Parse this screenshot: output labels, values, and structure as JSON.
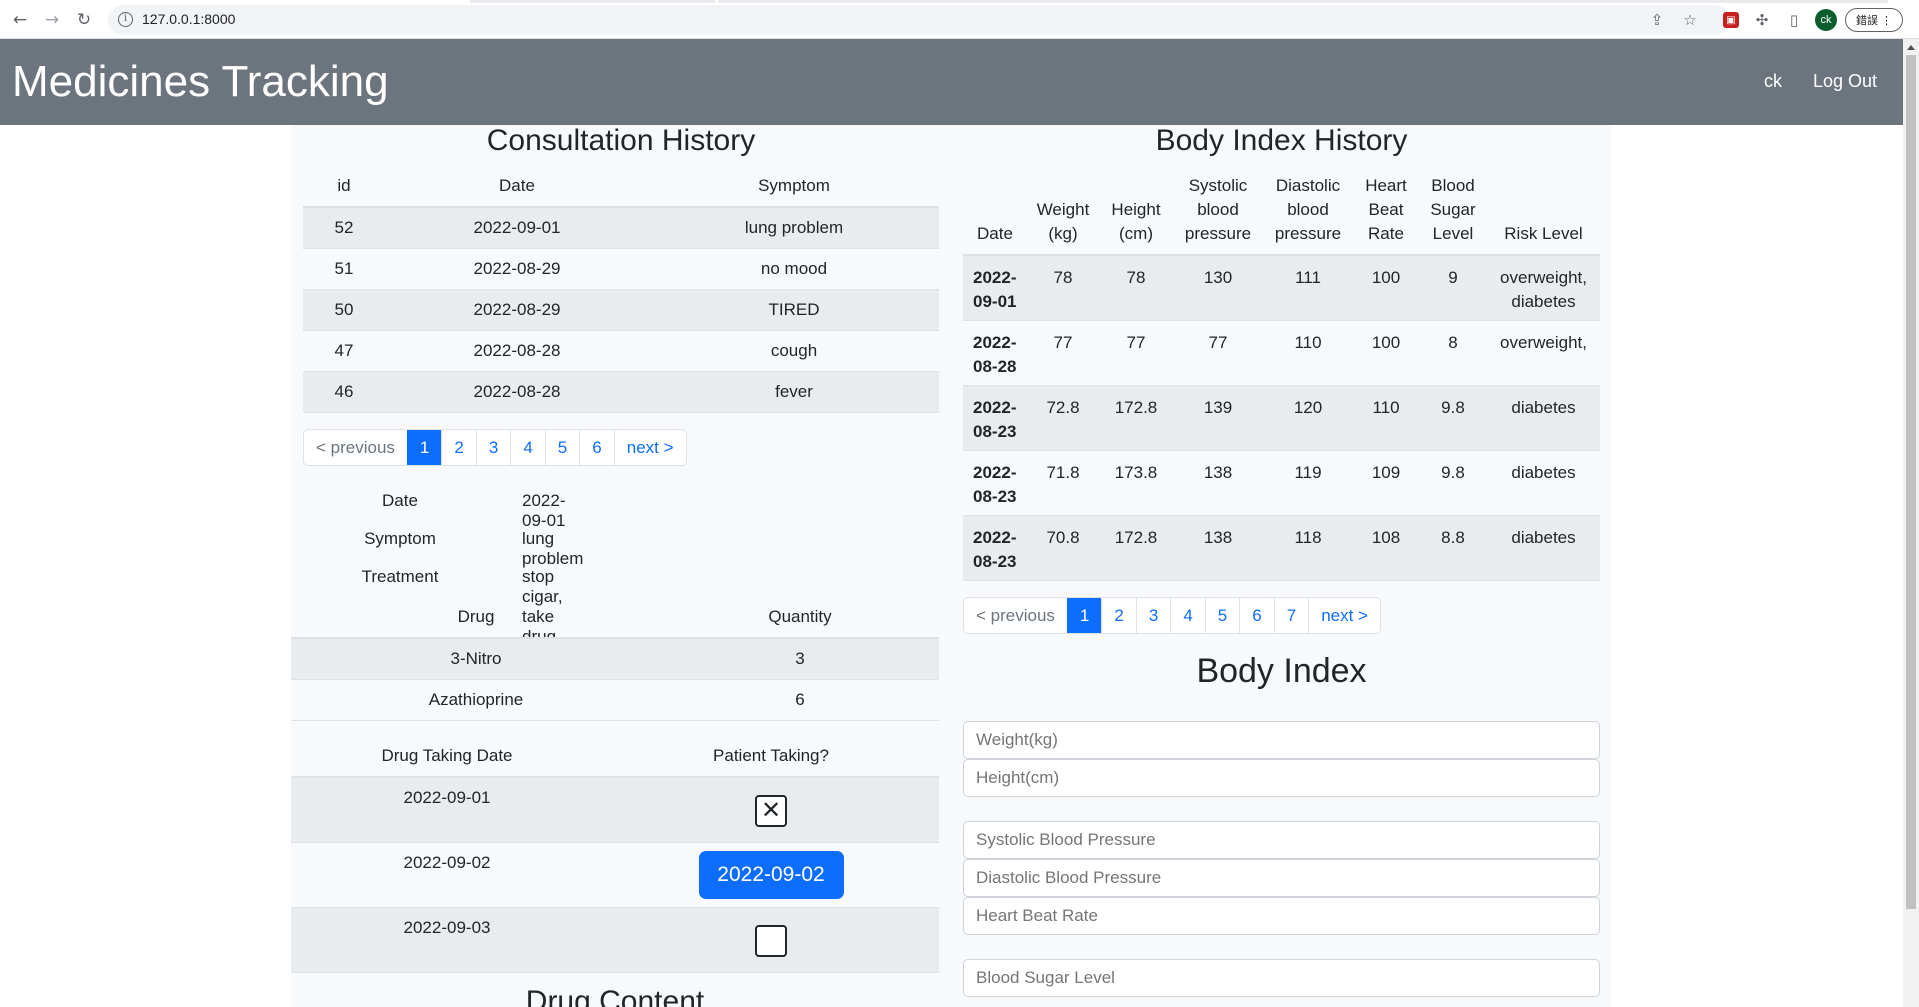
{
  "browser": {
    "url": "127.0.0.1:8000",
    "profile_initials": "ck",
    "update_label": "錯誤"
  },
  "navbar": {
    "brand": "Medicines Tracking",
    "user": "ck",
    "logout": "Log Out"
  },
  "consultation": {
    "title": "Consultation History",
    "columns": [
      "id",
      "Date",
      "Symptom"
    ],
    "rows": [
      {
        "id": "52",
        "date": "2022-09-01",
        "symptom": "lung problem"
      },
      {
        "id": "51",
        "date": "2022-08-29",
        "symptom": "no mood"
      },
      {
        "id": "50",
        "date": "2022-08-29",
        "symptom": "TIRED"
      },
      {
        "id": "47",
        "date": "2022-08-28",
        "symptom": "cough"
      },
      {
        "id": "46",
        "date": "2022-08-28",
        "symptom": "fever"
      }
    ],
    "pager": [
      "< previous",
      "1",
      "2",
      "3",
      "4",
      "5",
      "6",
      "next >"
    ],
    "active_page": "1"
  },
  "detail": {
    "date_label": "Date",
    "date_value": "2022-09-01",
    "symptom_label": "Symptom",
    "symptom_value": "lung problem",
    "treatment_label": "Treatment",
    "treatment_value": "stop cigar, take drug"
  },
  "drugs": {
    "columns": [
      "Drug",
      "Quantity"
    ],
    "rows": [
      {
        "drug": "3-Nitro",
        "quantity": "3"
      },
      {
        "drug": "Azathioprine",
        "quantity": "6"
      }
    ]
  },
  "taking": {
    "columns": [
      "Drug Taking Date",
      "Patient Taking?"
    ],
    "rows": [
      {
        "date": "2022-09-01",
        "state": "checked",
        "mark": "✕"
      },
      {
        "date": "2022-09-02",
        "state": "button",
        "button_label": "2022-09-02"
      },
      {
        "date": "2022-09-03",
        "state": "unchecked"
      }
    ]
  },
  "drug_content_title": "Drug Content",
  "body_history": {
    "title": "Body Index History",
    "columns": [
      "Date",
      "Weight (kg)",
      "Height (cm)",
      "Systolic blood pressure",
      "Diastolic blood pressure",
      "Heart Beat Rate",
      "Blood Sugar Level",
      "Risk Level"
    ],
    "rows": [
      {
        "date": "2022-09-01",
        "weight": "78",
        "height": "78",
        "systolic": "130",
        "diastolic": "111",
        "heart": "100",
        "sugar": "9",
        "risk": "overweight, diabetes"
      },
      {
        "date": "2022-08-28",
        "weight": "77",
        "height": "77",
        "systolic": "77",
        "diastolic": "110",
        "heart": "100",
        "sugar": "8",
        "risk": "overweight,"
      },
      {
        "date": "2022-08-23",
        "weight": "72.8",
        "height": "172.8",
        "systolic": "139",
        "diastolic": "120",
        "heart": "110",
        "sugar": "9.8",
        "risk": "diabetes"
      },
      {
        "date": "2022-08-23",
        "weight": "71.8",
        "height": "173.8",
        "systolic": "138",
        "diastolic": "119",
        "heart": "109",
        "sugar": "9.8",
        "risk": "diabetes"
      },
      {
        "date": "2022-08-23",
        "weight": "70.8",
        "height": "172.8",
        "systolic": "138",
        "diastolic": "118",
        "heart": "108",
        "sugar": "8.8",
        "risk": "diabetes"
      }
    ],
    "pager": [
      "< previous",
      "1",
      "2",
      "3",
      "4",
      "5",
      "6",
      "7",
      "next >"
    ],
    "active_page": "1"
  },
  "body_index_form": {
    "title": "Body Index",
    "weight_placeholder": "Weight(kg)",
    "height_placeholder": "Height(cm)",
    "systolic_placeholder": "Systolic Blood Pressure",
    "diastolic_placeholder": "Diastolic Blood Pressure",
    "heart_placeholder": "Heart Beat Rate",
    "sugar_placeholder": "Blood Sugar Level"
  },
  "colors": {
    "navbar": "#6c757d",
    "primary": "#0d6efd",
    "stripe": "#e9ecef",
    "panel": "#f8f9fa"
  }
}
